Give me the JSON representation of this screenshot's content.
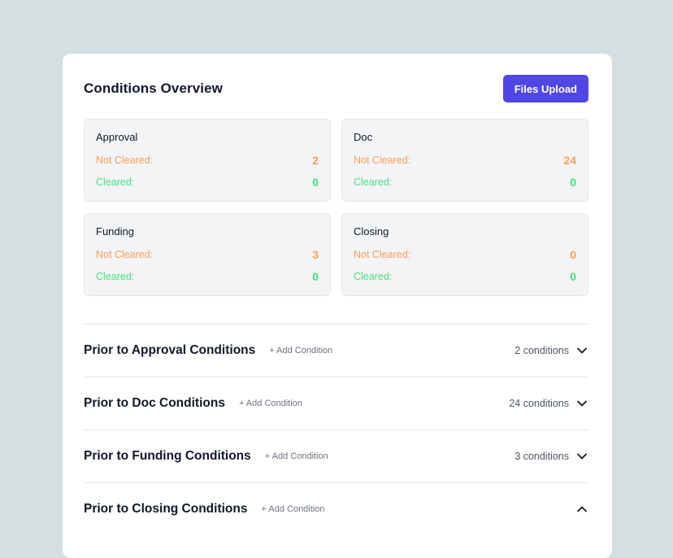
{
  "header": {
    "title": "Conditions Overview",
    "upload_label": "Files Upload"
  },
  "stats": [
    {
      "name": "Approval",
      "not_cleared_label": "Not Cleared:",
      "not_cleared": "2",
      "cleared_label": "Cleared:",
      "cleared": "0"
    },
    {
      "name": "Doc",
      "not_cleared_label": "Not Cleared:",
      "not_cleared": "24",
      "cleared_label": "Cleared:",
      "cleared": "0"
    },
    {
      "name": "Funding",
      "not_cleared_label": "Not Cleared:",
      "not_cleared": "3",
      "cleared_label": "Cleared:",
      "cleared": "0"
    },
    {
      "name": "Closing",
      "not_cleared_label": "Not Cleared:",
      "not_cleared": "0",
      "cleared_label": "Cleared:",
      "cleared": "0"
    }
  ],
  "sections": [
    {
      "title": "Prior to Approval Conditions",
      "add_label": "+ Add Condition",
      "count": "2 conditions",
      "chevron": "chevron-down-icon"
    },
    {
      "title": "Prior to Doc Conditions",
      "add_label": "+ Add Condition",
      "count": "24 conditions",
      "chevron": "chevron-down-icon"
    },
    {
      "title": "Prior to Funding Conditions",
      "add_label": "+ Add Condition",
      "count": "3 conditions",
      "chevron": "chevron-down-icon"
    },
    {
      "title": "Prior to Closing Conditions",
      "add_label": "+ Add Condition",
      "count": "",
      "chevron": "chevron-up-icon"
    }
  ],
  "colors": {
    "accent": "#4f46e5",
    "not_cleared": "#f59e5b",
    "cleared": "#4ade80",
    "background": "#d3e0df"
  }
}
